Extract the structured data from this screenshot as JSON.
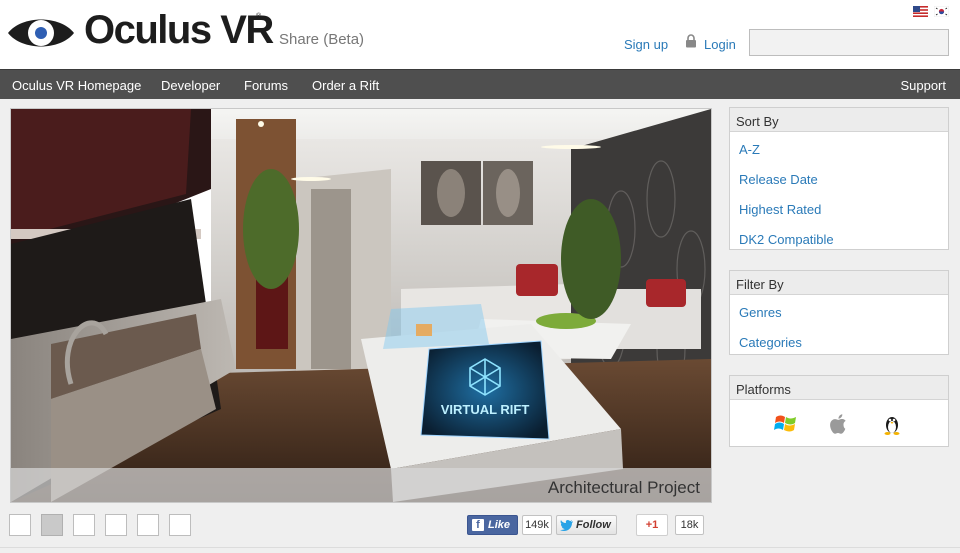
{
  "header": {
    "logo_text": "Oculus VR",
    "logo_reg": "®",
    "subtitle": "Share (Beta)",
    "signup": "Sign up",
    "login": "Login",
    "login_input_value": ""
  },
  "nav": {
    "items": [
      "Oculus VR Homepage",
      "Developer",
      "Forums",
      "Order a Rift"
    ],
    "support": "Support"
  },
  "hero": {
    "caption": "Architectural Project",
    "image_sign_text": "VIRTUAL RIFT",
    "thumbnails_count": 6,
    "active_thumbnail": 2
  },
  "social": {
    "like_label": "Like",
    "like_count": "149k",
    "follow_label": "Follow",
    "gplus_label": "+1",
    "gplus_count": "18k"
  },
  "sidebar": {
    "sort": {
      "title": "Sort By",
      "items": [
        "A-Z",
        "Release Date",
        "Highest Rated",
        "DK2 Compatible"
      ]
    },
    "filter": {
      "title": "Filter By",
      "items": [
        "Genres",
        "Categories"
      ]
    },
    "platforms": {
      "title": "Platforms",
      "icons": [
        "windows-icon",
        "apple-icon",
        "linux-icon"
      ]
    }
  },
  "colors": {
    "link": "#2a7ab8",
    "nav_bg": "#4f4f4f",
    "facebook": "#4a66a0",
    "gplus": "#d23f31"
  }
}
